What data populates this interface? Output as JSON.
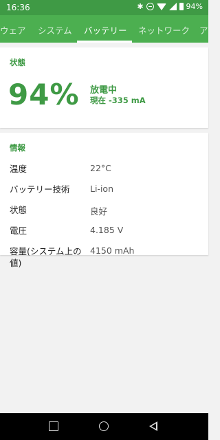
{
  "status_bar": {
    "time": "16:36",
    "battery_pct": "94%",
    "icons": [
      "bluetooth-icon",
      "do-not-disturb-icon",
      "wifi-icon",
      "signal-icon",
      "battery-icon"
    ]
  },
  "tabs": [
    {
      "label": "ウェア",
      "active": false
    },
    {
      "label": "システム",
      "active": false
    },
    {
      "label": "バッテリー",
      "active": true
    },
    {
      "label": "ネットワーク",
      "active": false
    },
    {
      "label": "ア",
      "active": false
    }
  ],
  "status_card": {
    "title": "状態",
    "percentage": "94%",
    "charge_state": "放電中",
    "current": "現在 -335 mA"
  },
  "info_card": {
    "title": "情報",
    "rows": [
      {
        "label": "温度",
        "value": "22°C"
      },
      {
        "label": "バッテリー技術",
        "value": "Li-ion"
      },
      {
        "label": "状態",
        "value": "良好"
      },
      {
        "label": "電圧",
        "value": "4.185 V"
      },
      {
        "label": "容量(システム上の値)",
        "value": "4150 mAh"
      }
    ]
  },
  "colors": {
    "status_bar": "#3f9a45",
    "tab_bar": "#4caf50",
    "accent": "#3f9a45",
    "background": "#f2f2f2"
  }
}
